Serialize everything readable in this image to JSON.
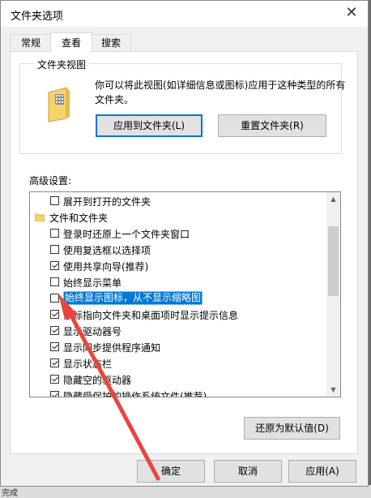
{
  "window": {
    "title": "文件夹选项"
  },
  "tabs": [
    {
      "label": "常规"
    },
    {
      "label": "查看"
    },
    {
      "label": "搜索"
    }
  ],
  "folder_view": {
    "title": "文件夹视图",
    "description": "你可以将此视图(如详细信息或图标)应用于这种类型的所有文件夹。",
    "apply_button": "应用到文件夹(L)",
    "reset_button": "重置文件夹(R)"
  },
  "advanced": {
    "label": "高级设置:",
    "items": [
      {
        "label": "展开到打开的文件夹",
        "checked": false
      },
      {
        "label": "文件和文件夹",
        "folder": true
      },
      {
        "label": "登录时还原上一个文件夹窗口",
        "checked": false
      },
      {
        "label": "使用复选框以选择项",
        "checked": false
      },
      {
        "label": "使用共享向导(推荐)",
        "checked": true
      },
      {
        "label": "始终显示菜单",
        "checked": false
      },
      {
        "label": "始终显示图标，从不显示缩略图",
        "checked": false,
        "selected": true
      },
      {
        "label": "鼠标指向文件夹和桌面项时显示提示信息",
        "checked": true
      },
      {
        "label": "显示驱动器号",
        "checked": true
      },
      {
        "label": "显示同步提供程序通知",
        "checked": true
      },
      {
        "label": "显示状态栏",
        "checked": true
      },
      {
        "label": "隐藏空的驱动器",
        "checked": true
      },
      {
        "label": "隐藏受保护的操作系统文件(推荐)",
        "checked": true
      }
    ],
    "restore_button": "还原为默认值(D)"
  },
  "footer": {
    "ok_button": "确定",
    "cancel_button": "取消",
    "apply_button": "应用(A)"
  },
  "background": {
    "status_text": "完成"
  },
  "colors": {
    "selection": "#0078d7",
    "annotation_arrow": "#e8463c"
  }
}
